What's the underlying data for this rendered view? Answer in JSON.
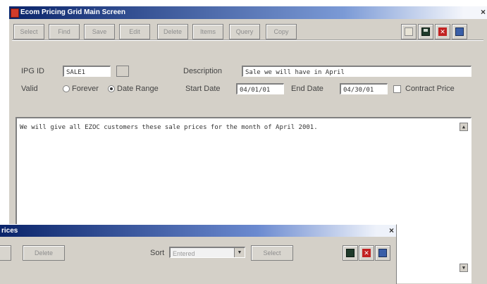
{
  "window": {
    "title": "Ecom Pricing Grid Main Screen",
    "close": "×"
  },
  "toolbar": {
    "buttons": [
      "Select",
      "Find",
      "Save",
      "Edit",
      "Delete",
      "Items",
      "Query",
      "Copy"
    ]
  },
  "form": {
    "ipg_label": "IPG ID",
    "ipg_value": "SALE1",
    "description_label": "Description",
    "description_value": "Sale we will have in April",
    "valid_label": "Valid",
    "forever_label": "Forever",
    "date_range_label": "Date Range",
    "start_label": "Start Date",
    "start_value": "04/01/01",
    "end_label": "End Date",
    "end_value": "04/30/01",
    "contract_label": "Contract Price",
    "valid_selected": "Date Range"
  },
  "memo": {
    "text": "We will give all EZOC customers these sale prices for the month of April 2001."
  },
  "subwindow": {
    "title": "rices",
    "delete_label": "Delete",
    "sort_label": "Sort",
    "sort_value": "Entered",
    "select_label": "Select",
    "close": "×"
  },
  "colors": {
    "titlebar": "#0a246a",
    "face": "#d4d0c8"
  }
}
